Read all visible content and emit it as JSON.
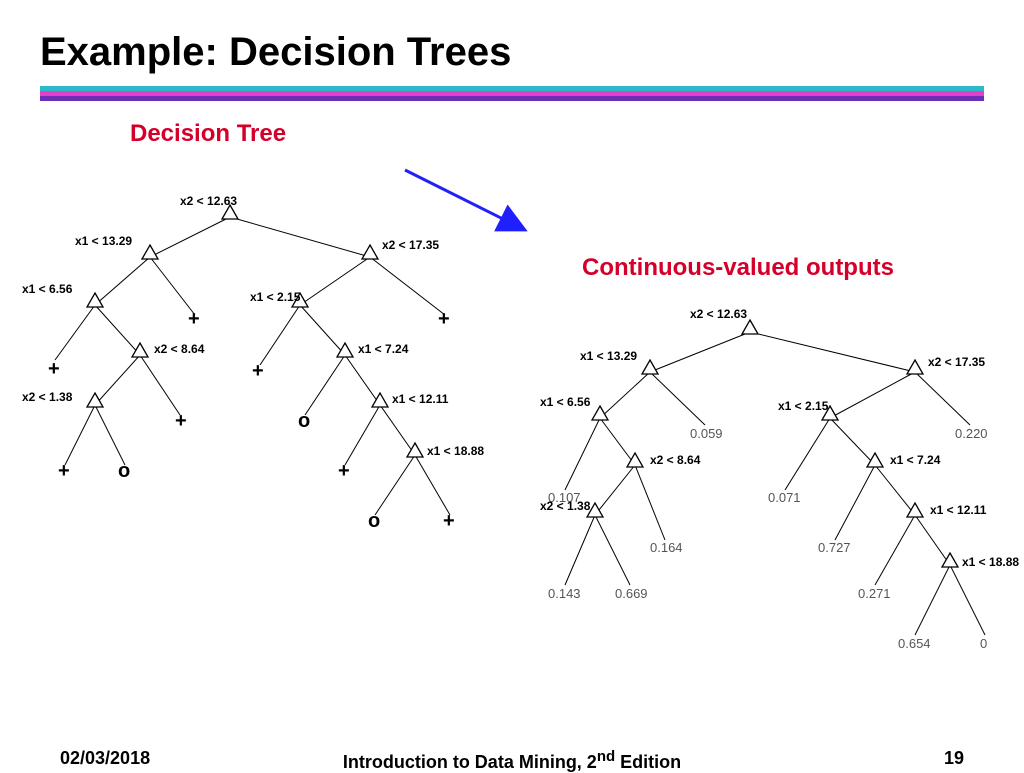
{
  "title": "Example: Decision Trees",
  "subtitle1": "Decision Tree",
  "subtitle2": "Continuous-valued outputs",
  "footer": {
    "date": "02/03/2018",
    "book_prefix": "Introduction to Data Mining, 2",
    "book_sup": "nd",
    "book_suffix": " Edition",
    "page": "19"
  },
  "left_nodes": {
    "n1": "x2 < 12.63",
    "n2": "x1 < 13.29",
    "n3": "x2 < 17.35",
    "n4": "x1 < 6.56",
    "n5": "x1 < 2.15",
    "n6": "x2 < 8.64",
    "n7": "x1 < 7.24",
    "n8": "x2 < 1.38",
    "n9": "x1 < 12.11",
    "n10": "x1 < 18.88"
  },
  "left_leaves": {
    "l1": "+",
    "l2": "+",
    "l3": "+",
    "l4": "+",
    "l5": "+",
    "l6": "o",
    "l7": "o",
    "l8": "+",
    "l9": "o",
    "l10": "+",
    "l11": "+"
  },
  "right_nodes": {
    "n1": "x2 < 12.63",
    "n2": "x1 < 13.29",
    "n3": "x2 < 17.35",
    "n4": "x1 < 6.56",
    "n5": "x1 < 2.15",
    "n6": "x2 < 8.64",
    "n7": "x1 < 7.24",
    "n8": "x2 < 1.38",
    "n9": "x1 < 12.11",
    "n10": "x1 < 18.88"
  },
  "right_leaves": {
    "l1": "0.059",
    "l2": "0.220",
    "l3": "0.107",
    "l4": "0.071",
    "l5": "0.164",
    "l6": "0.727",
    "l7": "0.143",
    "l8": "0.669",
    "l9": "0.271",
    "l10": "0.654",
    "l11": "0"
  }
}
